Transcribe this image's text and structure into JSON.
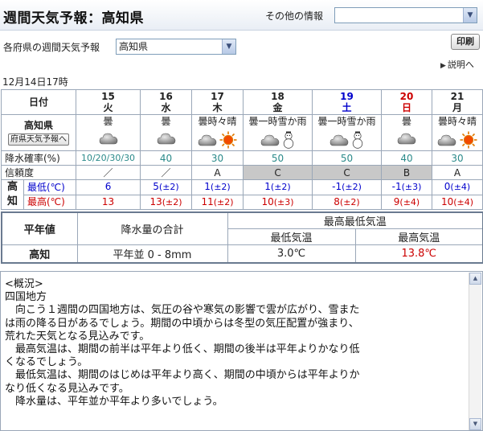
{
  "header": {
    "title": "週間天気予報：高知県",
    "other_info_label": "その他の情報",
    "other_info_value": ""
  },
  "pref_selector": {
    "label": "各府県の週間天気予報",
    "value": "高知県"
  },
  "print_label": "印刷",
  "explain_label": "説明へ",
  "issued": "12月14日17時",
  "table": {
    "date_label": "日付",
    "pref_name": "高知県",
    "pref_button": "府県天気予報へ",
    "pop_label": "降水確率(%)",
    "reliability_label": "信頼度",
    "area_char1": "高",
    "area_char2": "知",
    "min_label": "最低(℃)",
    "max_label": "最高(℃)",
    "days": [
      {
        "num": "15",
        "dow": "火",
        "wx": "曇",
        "icons": [
          "cloud"
        ],
        "pop": "10/20/30/30",
        "rel": "／",
        "rel_gray": false,
        "min": "6",
        "min_err": "",
        "max": "13",
        "max_err": "",
        "kind": ""
      },
      {
        "num": "16",
        "dow": "水",
        "wx": "曇",
        "icons": [
          "cloud"
        ],
        "pop": "40",
        "rel": "／",
        "rel_gray": false,
        "min": "5",
        "min_err": "(±2)",
        "max": "13",
        "max_err": "(±2)",
        "kind": ""
      },
      {
        "num": "17",
        "dow": "木",
        "wx": "曇時々晴",
        "icons": [
          "cloud",
          "sun"
        ],
        "pop": "30",
        "rel": "A",
        "rel_gray": false,
        "min": "1",
        "min_err": "(±2)",
        "max": "11",
        "max_err": "(±2)",
        "kind": ""
      },
      {
        "num": "18",
        "dow": "金",
        "wx": "曇一時雪か雨",
        "icons": [
          "cloud",
          "snowman"
        ],
        "pop": "50",
        "rel": "C",
        "rel_gray": true,
        "min": "1",
        "min_err": "(±2)",
        "max": "10",
        "max_err": "(±3)",
        "kind": ""
      },
      {
        "num": "19",
        "dow": "土",
        "wx": "曇一時雪か雨",
        "icons": [
          "cloud",
          "snowman"
        ],
        "pop": "50",
        "rel": "C",
        "rel_gray": true,
        "min": "-1",
        "min_err": "(±2)",
        "max": "8",
        "max_err": "(±2)",
        "kind": "sat"
      },
      {
        "num": "20",
        "dow": "日",
        "wx": "曇",
        "icons": [
          "cloud"
        ],
        "pop": "40",
        "rel": "B",
        "rel_gray": true,
        "min": "-1",
        "min_err": "(±3)",
        "max": "9",
        "max_err": "(±4)",
        "kind": "sun"
      },
      {
        "num": "21",
        "dow": "月",
        "wx": "曇時々晴",
        "icons": [
          "cloud",
          "sun"
        ],
        "pop": "30",
        "rel": "A",
        "rel_gray": false,
        "min": "0",
        "min_err": "(±4)",
        "max": "10",
        "max_err": "(±4)",
        "kind": ""
      }
    ]
  },
  "normals": {
    "heading": "平年値",
    "precip_heading": "降水量の合計",
    "temp_heading": "最高最低気温",
    "min_heading": "最低気温",
    "max_heading": "最高気温",
    "station": "高知",
    "precip_value": "平年並 0 - 8mm",
    "min_value": "3.0℃",
    "max_value": "13.8℃"
  },
  "outlook": {
    "text": "<概況>\n四国地方\n　向こう１週間の四国地方は、気圧の谷や寒気の影響で雲が広がり、雪また\nは雨の降る日があるでしょう。期間の中頃からは冬型の気圧配置が強まり、\n荒れた天気となる見込みです。\n　最高気温は、期間の前半は平年より低く、期間の後半は平年よりかなり低\nくなるでしょう。\n　最低気温は、期間のはじめは平年より高く、期間の中頃からは平年よりか\nなり低くなる見込みです。\n　降水量は、平年並か平年より多いでしょう。"
  },
  "colors": {
    "saturday": "#0000cc",
    "sunday": "#cc0000",
    "pop": "#2a8a8a",
    "reliability_gray": "#c8c8c8",
    "normal_max": "#cc0000"
  }
}
